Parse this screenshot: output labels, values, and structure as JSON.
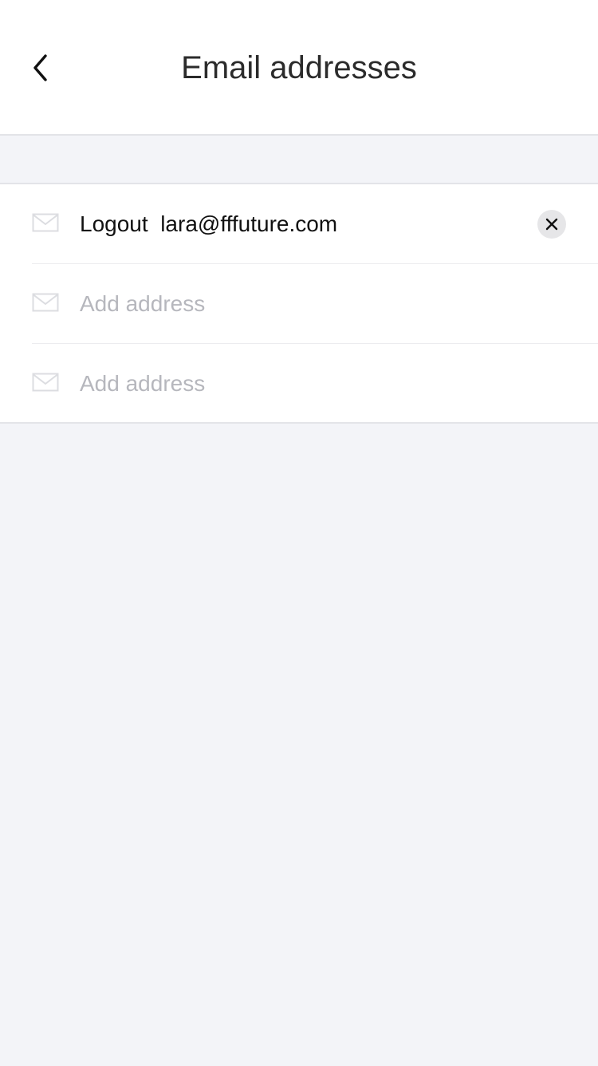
{
  "header": {
    "title": "Email addresses",
    "back_icon": "chevron-left-icon"
  },
  "emails": [
    {
      "value": "Logout  lara@fffuture.com",
      "placeholder": "",
      "is_filled": true,
      "icon": "mail-icon",
      "clear_icon": "close-icon"
    },
    {
      "value": "",
      "placeholder": "Add address",
      "is_filled": false,
      "icon": "mail-icon"
    },
    {
      "value": "",
      "placeholder": "Add address",
      "is_filled": false,
      "icon": "mail-icon"
    }
  ],
  "colors": {
    "background": "#f3f4f8",
    "surface": "#ffffff",
    "text": "#111111",
    "placeholder": "#b6b7bd",
    "divider": "#e3e4e8",
    "clear_button_bg": "#e6e6e8"
  }
}
